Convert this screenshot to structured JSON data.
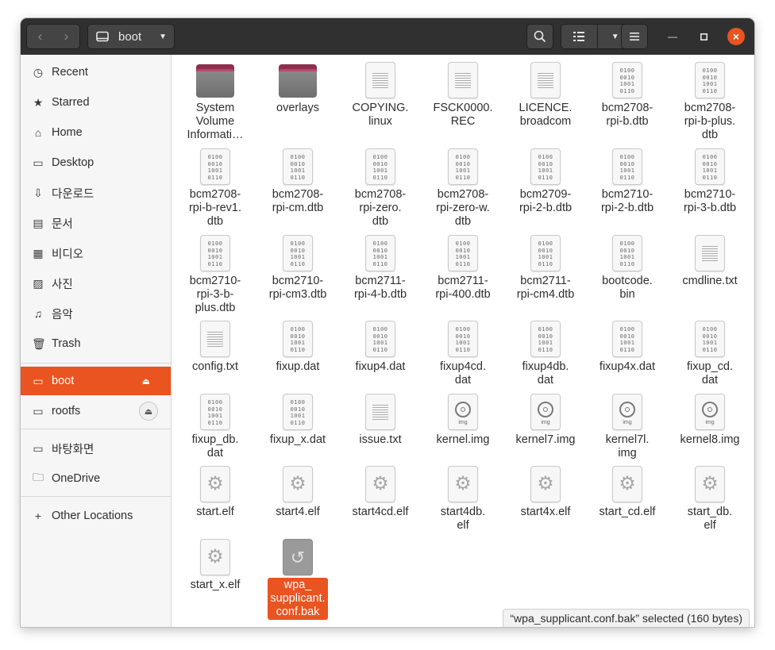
{
  "header": {
    "path_label": "boot",
    "back_icon": "chevron-left-icon",
    "forward_icon": "chevron-right-icon",
    "accent": "#e95420"
  },
  "sidebar": {
    "places": [
      {
        "label": "Recent",
        "icon": "clock-icon"
      },
      {
        "label": "Starred",
        "icon": "star-icon"
      },
      {
        "label": "Home",
        "icon": "home-icon"
      },
      {
        "label": "Desktop",
        "icon": "desktop-icon"
      },
      {
        "label": "다운로드",
        "icon": "download-icon"
      },
      {
        "label": "문서",
        "icon": "document-icon"
      },
      {
        "label": "비디오",
        "icon": "video-icon"
      },
      {
        "label": "사진",
        "icon": "picture-icon"
      },
      {
        "label": "음악",
        "icon": "music-icon"
      },
      {
        "label": "Trash",
        "icon": "trash-icon"
      }
    ],
    "devices": [
      {
        "label": "boot",
        "icon": "drive-icon",
        "active": true
      },
      {
        "label": "rootfs",
        "icon": "drive-icon",
        "active": false
      }
    ],
    "bookmarks": [
      {
        "label": "바탕화면",
        "icon": "desktop-icon"
      },
      {
        "label": "OneDrive",
        "icon": "folder-icon"
      }
    ],
    "other": {
      "label": "Other Locations",
      "icon": "plus-icon"
    }
  },
  "files": [
    {
      "name": "System\nVolume\nInformati…",
      "type": "folder"
    },
    {
      "name": "overlays",
      "type": "folder"
    },
    {
      "name": "COPYING.\nlinux",
      "type": "text"
    },
    {
      "name": "FSCK0000.\nREC",
      "type": "text"
    },
    {
      "name": "LICENCE.\nbroadcom",
      "type": "text"
    },
    {
      "name": "bcm2708-\nrpi-b.dtb",
      "type": "binary"
    },
    {
      "name": "bcm2708-\nrpi-b-plus.\ndtb",
      "type": "binary"
    },
    {
      "name": "bcm2708-\nrpi-b-rev1.\ndtb",
      "type": "binary"
    },
    {
      "name": "bcm2708-\nrpi-cm.dtb",
      "type": "binary"
    },
    {
      "name": "bcm2708-\nrpi-zero.\ndtb",
      "type": "binary"
    },
    {
      "name": "bcm2708-\nrpi-zero-w.\ndtb",
      "type": "binary"
    },
    {
      "name": "bcm2709-\nrpi-2-b.dtb",
      "type": "binary"
    },
    {
      "name": "bcm2710-\nrpi-2-b.dtb",
      "type": "binary"
    },
    {
      "name": "bcm2710-\nrpi-3-b.dtb",
      "type": "binary"
    },
    {
      "name": "bcm2710-\nrpi-3-b-\nplus.dtb",
      "type": "binary"
    },
    {
      "name": "bcm2710-\nrpi-cm3.dtb",
      "type": "binary"
    },
    {
      "name": "bcm2711-\nrpi-4-b.dtb",
      "type": "binary"
    },
    {
      "name": "bcm2711-\nrpi-400.dtb",
      "type": "binary"
    },
    {
      "name": "bcm2711-\nrpi-cm4.dtb",
      "type": "binary"
    },
    {
      "name": "bootcode.\nbin",
      "type": "binary"
    },
    {
      "name": "cmdline.txt",
      "type": "text"
    },
    {
      "name": "config.txt",
      "type": "text"
    },
    {
      "name": "fixup.dat",
      "type": "binary"
    },
    {
      "name": "fixup4.dat",
      "type": "binary"
    },
    {
      "name": "fixup4cd.\ndat",
      "type": "binary"
    },
    {
      "name": "fixup4db.\ndat",
      "type": "binary"
    },
    {
      "name": "fixup4x.dat",
      "type": "binary"
    },
    {
      "name": "fixup_cd.\ndat",
      "type": "binary"
    },
    {
      "name": "fixup_db.\ndat",
      "type": "binary"
    },
    {
      "name": "fixup_x.dat",
      "type": "binary"
    },
    {
      "name": "issue.txt",
      "type": "text"
    },
    {
      "name": "kernel.img",
      "type": "image"
    },
    {
      "name": "kernel7.img",
      "type": "image"
    },
    {
      "name": "kernel7l.\nimg",
      "type": "image"
    },
    {
      "name": "kernel8.img",
      "type": "image"
    },
    {
      "name": "start.elf",
      "type": "exec"
    },
    {
      "name": "start4.elf",
      "type": "exec"
    },
    {
      "name": "start4cd.elf",
      "type": "exec"
    },
    {
      "name": "start4db.\nelf",
      "type": "exec"
    },
    {
      "name": "start4x.elf",
      "type": "exec"
    },
    {
      "name": "start_cd.elf",
      "type": "exec"
    },
    {
      "name": "start_db.\nelf",
      "type": "exec"
    },
    {
      "name": "start_x.elf",
      "type": "exec"
    },
    {
      "name": "wpa_\nsupplicant.\nconf.bak",
      "type": "backup",
      "selected": true
    }
  ],
  "binary_glyph": "0100\n0010\n1001\n0110",
  "image_tag": "img",
  "status": "“wpa_supplicant.conf.bak” selected  (160 bytes)"
}
